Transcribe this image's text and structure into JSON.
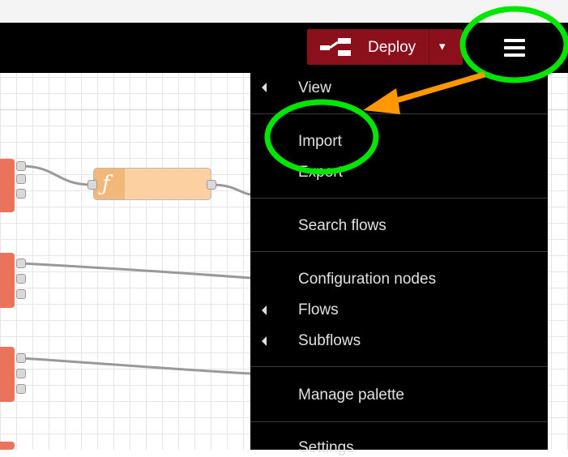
{
  "header": {
    "deploy_label": "Deploy",
    "deploy_icon": "deploy-icon",
    "deploy_caret": "▾",
    "menu_icon": "hamburger-menu-icon"
  },
  "menu": {
    "items": [
      {
        "label": "View",
        "submenu": true
      },
      {
        "label": "Import",
        "submenu": false
      },
      {
        "label": "Export",
        "submenu": false
      },
      {
        "label": "Search flows",
        "submenu": false
      },
      {
        "label": "Configuration nodes",
        "submenu": false
      },
      {
        "label": "Flows",
        "submenu": true
      },
      {
        "label": "Subflows",
        "submenu": true
      },
      {
        "label": "Manage palette",
        "submenu": false
      },
      {
        "label": "Settings",
        "submenu": false
      }
    ]
  },
  "canvas": {
    "function_node_icon": "function-icon",
    "function_glyph": "ƒ"
  },
  "annotations": {
    "highlight_color": "#00e600",
    "arrow_color": "#ff9800"
  },
  "colors": {
    "deploy": "#8c101c",
    "menu_bg": "#000000",
    "header_bg": "#000000"
  }
}
